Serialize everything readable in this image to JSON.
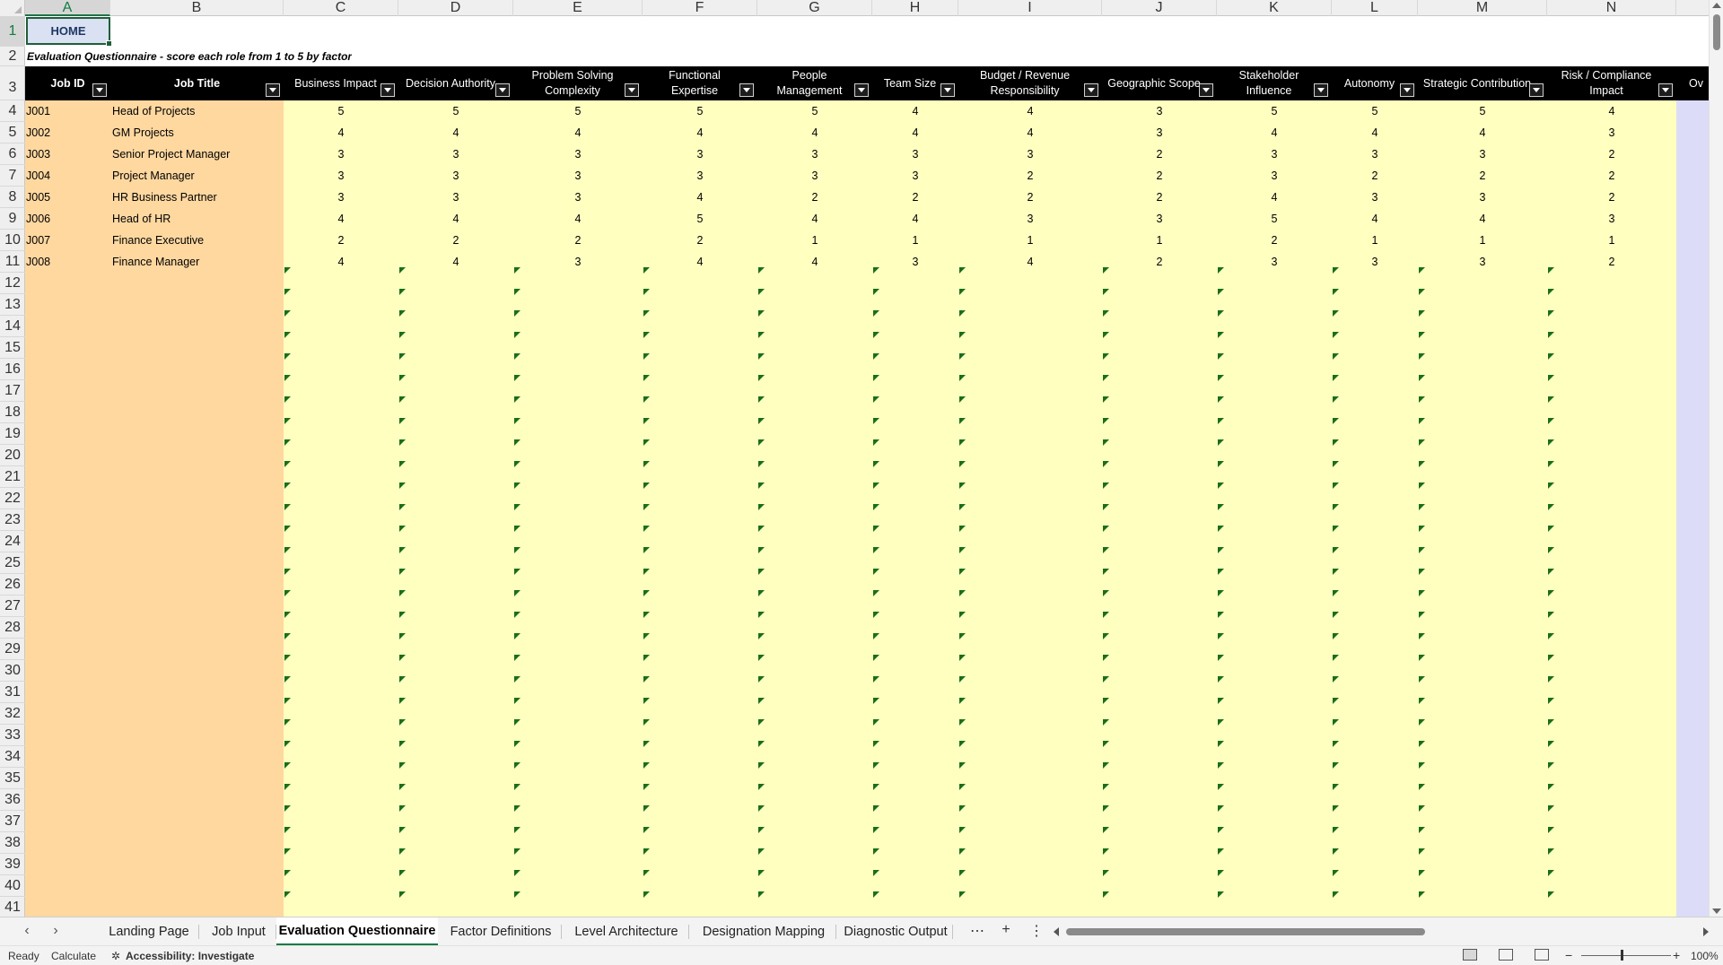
{
  "columns": [
    "A",
    "B",
    "C",
    "D",
    "E",
    "F",
    "G",
    "H",
    "I",
    "J",
    "K",
    "L",
    "M",
    "N"
  ],
  "home_label": "HOME",
  "subtitle": "Evaluation Questionnaire - score each role from 1 to 5 by factor",
  "headers": {
    "job_id": "Job ID",
    "job_title": "Job Title",
    "factors": [
      "Business Impact",
      "Decision Authority",
      "Problem Solving Complexity",
      "Functional Expertise",
      "People Management",
      "Team Size",
      "Budget / Revenue Responsibility",
      "Geographic Scope",
      "Stakeholder Influence",
      "Autonomy",
      "Strategic Contribution",
      "Risk / Compliance Impact"
    ],
    "overflow": "Ov"
  },
  "rows": [
    {
      "id": "J001",
      "title": "Head of Projects",
      "scores": [
        5,
        5,
        5,
        5,
        5,
        4,
        4,
        3,
        5,
        5,
        5,
        4
      ]
    },
    {
      "id": "J002",
      "title": "GM Projects",
      "scores": [
        4,
        4,
        4,
        4,
        4,
        4,
        4,
        3,
        4,
        4,
        4,
        3
      ]
    },
    {
      "id": "J003",
      "title": "Senior Project Manager",
      "scores": [
        3,
        3,
        3,
        3,
        3,
        3,
        3,
        2,
        3,
        3,
        3,
        2
      ]
    },
    {
      "id": "J004",
      "title": "Project Manager",
      "scores": [
        3,
        3,
        3,
        3,
        3,
        3,
        2,
        2,
        3,
        2,
        2,
        2
      ]
    },
    {
      "id": "J005",
      "title": "HR Business Partner",
      "scores": [
        3,
        3,
        3,
        4,
        2,
        2,
        2,
        2,
        4,
        3,
        3,
        2
      ]
    },
    {
      "id": "J006",
      "title": "Head of HR",
      "scores": [
        4,
        4,
        4,
        5,
        4,
        4,
        3,
        3,
        5,
        4,
        4,
        3
      ]
    },
    {
      "id": "J007",
      "title": "Finance Executive",
      "scores": [
        2,
        2,
        2,
        2,
        1,
        1,
        1,
        1,
        2,
        1,
        1,
        1
      ]
    },
    {
      "id": "J008",
      "title": "Finance Manager",
      "scores": [
        4,
        4,
        3,
        4,
        4,
        3,
        4,
        2,
        3,
        3,
        3,
        2
      ]
    }
  ],
  "sheet_tabs": [
    "Landing Page",
    "Job Input",
    "Evaluation Questionnaire",
    "Factor Definitions",
    "Level Architecture",
    "Designation Mapping",
    "Diagnostic Output"
  ],
  "active_tab": "Evaluation Questionnaire",
  "status": {
    "ready": "Ready",
    "calculate": "Calculate",
    "accessibility": "Accessibility: Investigate",
    "zoom": "100%"
  },
  "colors": {
    "accent": "#107c41",
    "header_bg": "#000000",
    "id_fill": "#ffd8a0",
    "score_fill": "#ffffc0",
    "side_fill": "#dcdcf8"
  },
  "icons": [
    "filter-dropdown-icon",
    "scroll-left-icon",
    "scroll-right-icon",
    "more-tabs-icon",
    "add-sheet-icon",
    "options-icon",
    "accessibility-icon",
    "normal-view-icon",
    "page-layout-icon",
    "page-break-icon"
  ]
}
